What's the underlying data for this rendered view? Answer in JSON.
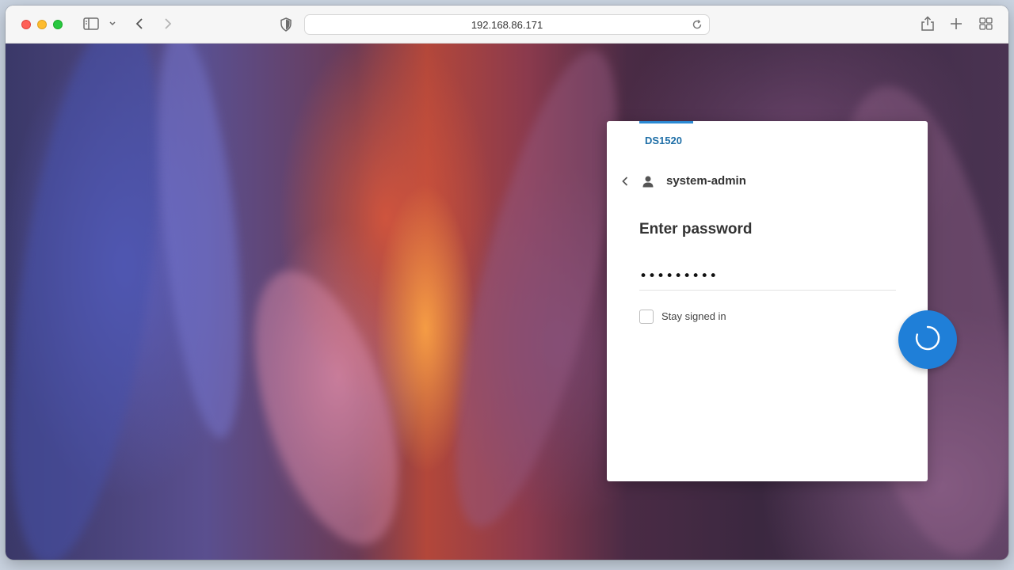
{
  "browser": {
    "url": "192.168.86.171",
    "icons": {
      "sidebar": "sidebar-icon",
      "back": "chevron-left-icon",
      "forward": "chevron-right-icon",
      "privacy": "shield-icon",
      "reload": "reload-icon",
      "share": "share-icon",
      "new_tab": "plus-icon",
      "tab_overview": "grid-icon"
    }
  },
  "login": {
    "host_label": "DS1520",
    "username": "system-admin",
    "heading": "Enter password",
    "password_value": "•••••••••",
    "stay_signed_in_label": "Stay signed in",
    "stay_signed_in_checked": false,
    "submit_state": "loading"
  },
  "colors": {
    "accent": "#2b8ad4",
    "submit_button": "#1f7fd8",
    "host_label": "#1f6fa7"
  }
}
